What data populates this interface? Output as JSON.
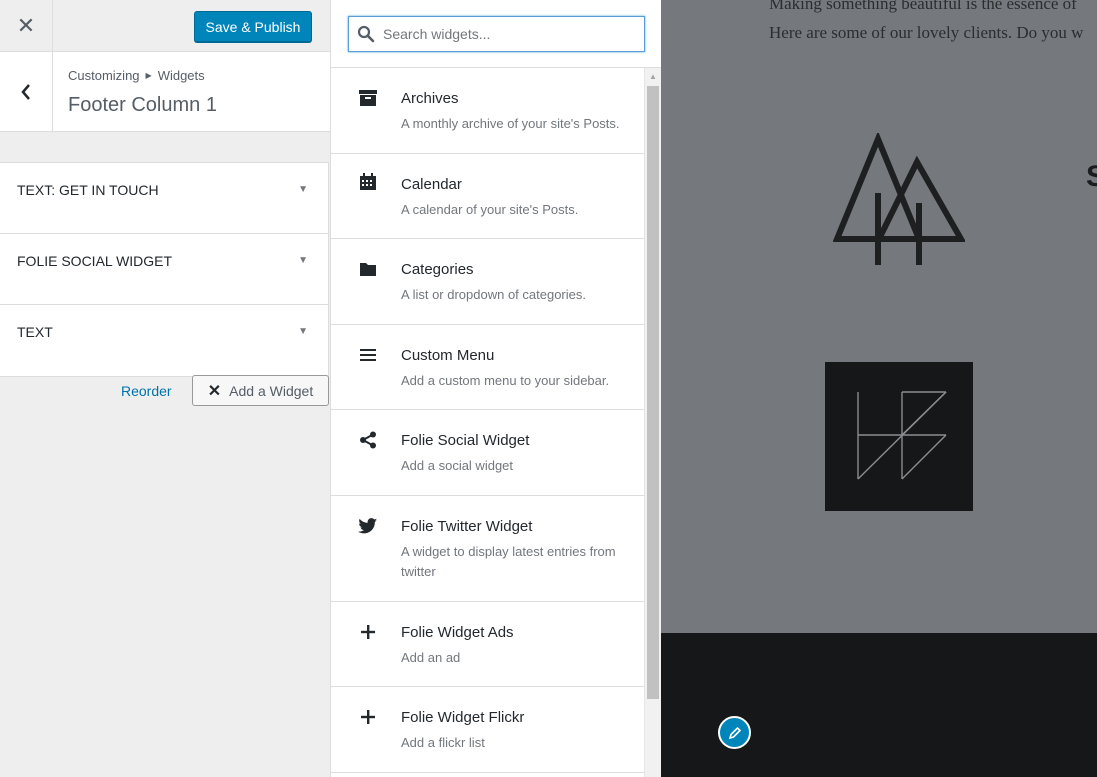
{
  "topbar": {
    "close_label": "✕",
    "save_label": "Save & Publish"
  },
  "section": {
    "breadcrumb": [
      "Customizing",
      "Widgets"
    ],
    "title": "Footer Column 1"
  },
  "widgets": [
    {
      "title": "TEXT: GET IN TOUCH"
    },
    {
      "title": "FOLIE SOCIAL WIDGET"
    },
    {
      "title": "TEXT"
    }
  ],
  "actions": {
    "reorder_label": "Reorder",
    "add_widget_label": "Add a Widget"
  },
  "search": {
    "placeholder": "Search widgets..."
  },
  "available_widgets": [
    {
      "name": "Archives",
      "desc": "A monthly archive of your site's Posts.",
      "icon": "archive-icon"
    },
    {
      "name": "Calendar",
      "desc": "A calendar of your site's Posts.",
      "icon": "calendar-icon"
    },
    {
      "name": "Categories",
      "desc": "A list or dropdown of categories.",
      "icon": "folder-icon"
    },
    {
      "name": "Custom Menu",
      "desc": "Add a custom menu to your sidebar.",
      "icon": "menu-icon"
    },
    {
      "name": "Folie Social Widget",
      "desc": "Add a social widget",
      "icon": "share-icon"
    },
    {
      "name": "Folie Twitter Widget",
      "desc": "A widget to display latest entries from twitter",
      "icon": "twitter-icon"
    },
    {
      "name": "Folie Widget Ads",
      "desc": "Add an ad",
      "icon": "plus-icon"
    },
    {
      "name": "Folie Widget Flickr",
      "desc": "Add a flickr list",
      "icon": "plus-icon"
    }
  ],
  "preview": {
    "line1": "Making something beautiful is the essence of",
    "line2": "Here are some of our lovely clients. Do you w",
    "partial_heading": "S"
  },
  "colors": {
    "accent": "#0085ba",
    "link": "#0073aa"
  }
}
